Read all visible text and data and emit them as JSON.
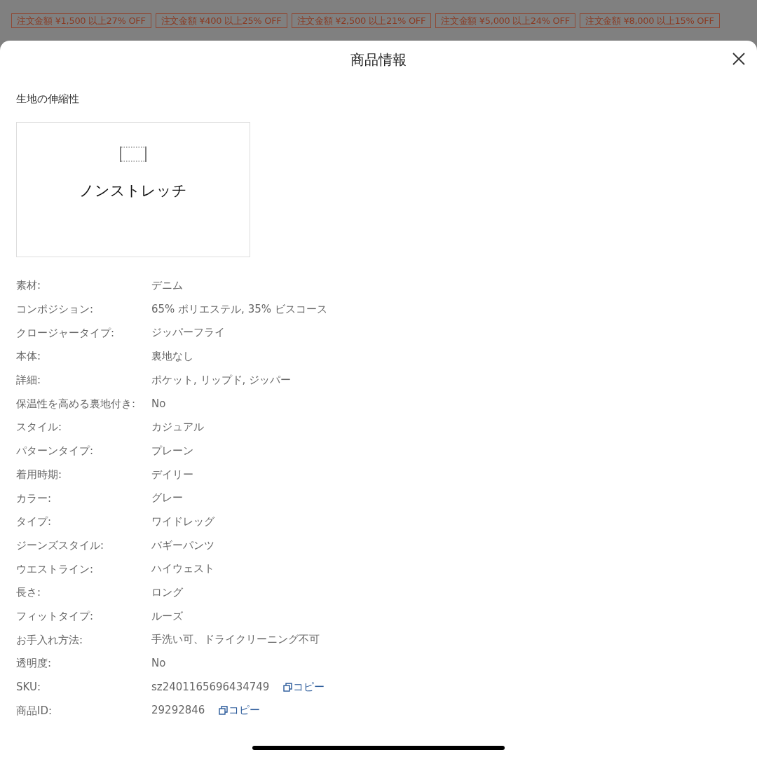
{
  "coupons": [
    {
      "label": "注文金額 ¥1,500 以上27% OFF"
    },
    {
      "label": "注文金額 ¥400 以上25% OFF"
    },
    {
      "label": "注文金額 ¥2,500 以上21% OFF"
    },
    {
      "label": "注文金額 ¥5,000 以上24% OFF"
    },
    {
      "label": "注文金額 ¥8,000 以上15% OFF"
    }
  ],
  "modal": {
    "title": "商品情報",
    "stretch": {
      "heading": "生地の伸縮性",
      "value": "ノンストレッチ"
    },
    "attributes": [
      {
        "label": "素材:",
        "value": "デニム"
      },
      {
        "label": "コンポジション:",
        "value": "65% ポリエステル, 35% ビスコース"
      },
      {
        "label": "クロージャータイプ:",
        "value": "ジッパーフライ"
      },
      {
        "label": "本体:",
        "value": "裏地なし"
      },
      {
        "label": "詳細:",
        "value": "ポケット, リップド, ジッパー"
      },
      {
        "label": "保温性を高める裏地付き:",
        "value": "No"
      },
      {
        "label": "スタイル:",
        "value": "カジュアル"
      },
      {
        "label": "パターンタイプ:",
        "value": "プレーン"
      },
      {
        "label": "着用時期:",
        "value": "デイリー"
      },
      {
        "label": "カラー:",
        "value": "グレー"
      },
      {
        "label": "タイプ:",
        "value": "ワイドレッグ"
      },
      {
        "label": "ジーンズスタイル:",
        "value": "バギーパンツ"
      },
      {
        "label": "ウエストライン:",
        "value": "ハイウェスト"
      },
      {
        "label": "長さ:",
        "value": "ロング"
      },
      {
        "label": "フィットタイプ:",
        "value": "ルーズ"
      },
      {
        "label": "お手入れ方法:",
        "value": "手洗い可、ドライクリーニング不可"
      },
      {
        "label": "透明度:",
        "value": "No"
      },
      {
        "label": "SKU:",
        "value": "sz2401165696434749",
        "copy": "コピー"
      },
      {
        "label": "商品ID:",
        "value": "29292846",
        "copy": "コピー"
      }
    ]
  }
}
